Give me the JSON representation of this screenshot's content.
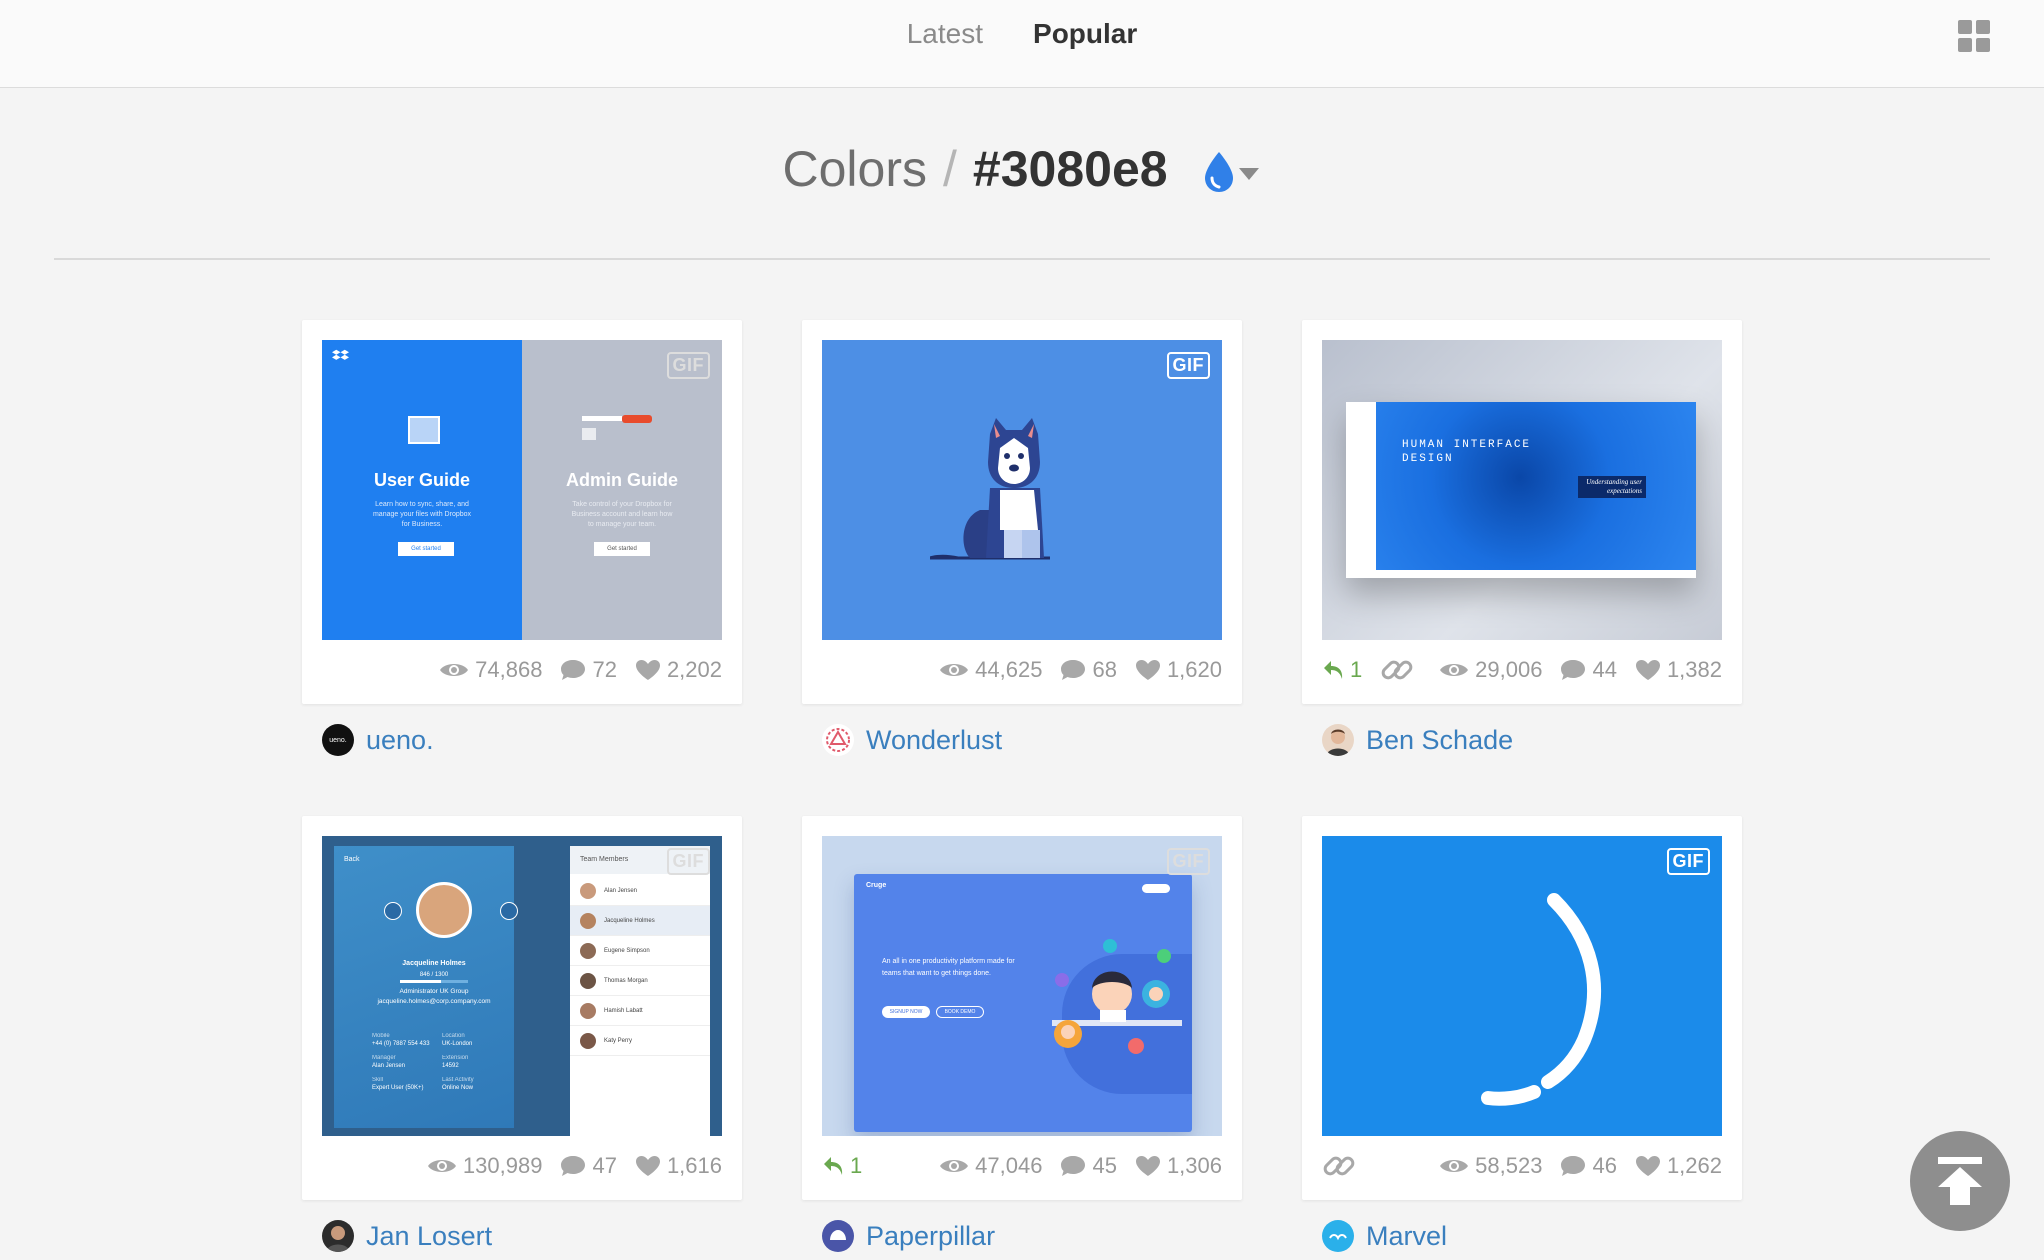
{
  "nav": {
    "tabs": [
      {
        "label": "Latest"
      },
      {
        "label": "Popular"
      }
    ]
  },
  "heading": {
    "crumb": "Colors",
    "separator": "/",
    "hex": "#3080e8"
  },
  "colors": {
    "accent": "#3080e8",
    "link": "#3a7fbe",
    "rebound": "#6aa84f"
  },
  "shots": [
    {
      "gif": "GIF",
      "views": "74,868",
      "comments": "72",
      "likes": "2,202",
      "author": "ueno.",
      "avatar_text": "ueno.",
      "thumb": {
        "left_title": "User Guide",
        "left_text": "Learn how to sync, share, and manage your files with Dropbox for Business.",
        "left_button": "Get started",
        "right_title": "Admin Guide",
        "right_text": "Take control of your Dropbox for Business account and learn how to manage your team.",
        "right_button": "Get started"
      }
    },
    {
      "gif": "GIF",
      "views": "44,625",
      "comments": "68",
      "likes": "1,620",
      "author": "Wonderlust"
    },
    {
      "rebounds": "1",
      "views": "29,006",
      "comments": "44",
      "likes": "1,382",
      "author": "Ben Schade",
      "thumb": {
        "title": "HUMAN INTERFACE\nDESIGN",
        "quote": "Understanding user expectations"
      }
    },
    {
      "gif": "GIF",
      "views": "130,989",
      "comments": "47",
      "likes": "1,616",
      "author": "Jan Losert",
      "thumb": {
        "back": "Back",
        "panel_title": "Team Members",
        "name": "Jacqueline Holmes",
        "progress": "846 / 1300",
        "role": "Administrator UK Group",
        "email": "jacqueline.holmes@corp.company.com",
        "fields": [
          {
            "label": "Mobile",
            "value": "+44 (0) 7887 554 433"
          },
          {
            "label": "Location",
            "value": "UK-London"
          },
          {
            "label": "Manager",
            "value": "Alan Jensen"
          },
          {
            "label": "Extension",
            "value": "14592"
          },
          {
            "label": "Skill",
            "value": "Expert User (50K+)"
          },
          {
            "label": "Last Activity",
            "value": "Online Now"
          }
        ],
        "members": [
          "Alan Jensen",
          "Jacqueline Holmes",
          "Eugene Simpson",
          "Thomas Morgan",
          "Hamish Labatt",
          "Katy Perry"
        ]
      }
    },
    {
      "gif": "GIF",
      "rebounds": "1",
      "views": "47,046",
      "comments": "45",
      "likes": "1,306",
      "author": "Paperpillar",
      "thumb": {
        "brand": "Cruge",
        "headline": "An all in one productivity platform made for teams that want to get things done.",
        "btn1": "SIGNUP NOW",
        "btn2": "BOOK DEMO"
      }
    },
    {
      "gif": "GIF",
      "views": "58,523",
      "comments": "46",
      "likes": "1,262",
      "author": "Marvel"
    }
  ]
}
